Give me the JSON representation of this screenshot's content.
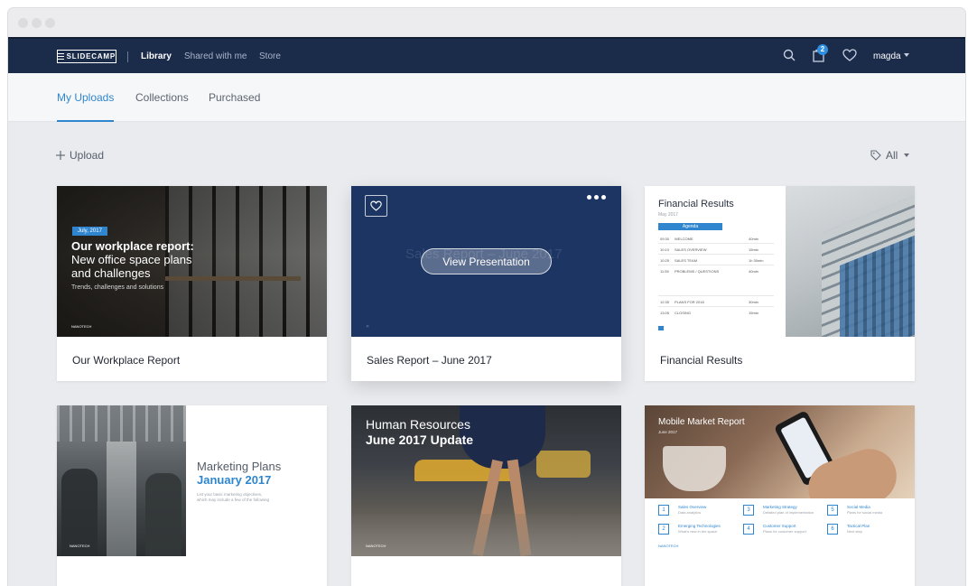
{
  "nav": {
    "logo_text": "SLIDECAMP",
    "links": [
      "Library",
      "Shared with me",
      "Store"
    ],
    "cart_count": "2",
    "user_name": "magda"
  },
  "tabs": [
    "My Uploads",
    "Collections",
    "Purchased"
  ],
  "toolbar": {
    "upload_label": "Upload",
    "filter_label": "All"
  },
  "hover": {
    "view_label": "View Presentation"
  },
  "cards": [
    {
      "title": "Our Workplace Report",
      "thumb": {
        "date_tag": "July, 2017",
        "heading": "Our workplace report:",
        "subheading_1": "New office space plans",
        "subheading_2": "and challenges",
        "small": "Trends, challenges and solutions",
        "logo": "NANOTECH"
      }
    },
    {
      "title": "Sales Report – June 2017",
      "thumb": {
        "faded": "Sales Report – June 2017"
      }
    },
    {
      "title": "Financial Results",
      "thumb": {
        "heading": "Financial Results",
        "date": "May 2017",
        "agenda": "Agenda",
        "rows": [
          [
            "09:30",
            "WELCOME",
            "40min"
          ],
          [
            "10:10",
            "SALES OVERVIEW",
            "15min"
          ],
          [
            "10:25",
            "SALES TEAM",
            "1h 30min"
          ],
          [
            "11:55",
            "PROBLEMS / QUESTIONS",
            "40min"
          ],
          [
            "12:35",
            "PLANS FOR 2018",
            "30min"
          ],
          [
            "13:05",
            "CLOSING",
            "15min"
          ]
        ]
      }
    },
    {
      "title": "",
      "thumb": {
        "heading": "Marketing Plans",
        "subheading": "January 2017",
        "small_1": "List your basic marketing objectives,",
        "small_2": "which may include a few of the following",
        "logo": "NANOTECH"
      }
    },
    {
      "title": "",
      "thumb": {
        "heading": "Human Resources",
        "subheading": "June 2017 Update",
        "logo": "NANOTECH"
      }
    },
    {
      "title": "",
      "thumb": {
        "heading": "Mobile Market Report",
        "date": "June 2017",
        "items": [
          {
            "n": "1",
            "t": "Sales Overview",
            "s": "Data analytics"
          },
          {
            "n": "3",
            "t": "Marketing Strategy",
            "s": "Detailed plan of implementation"
          },
          {
            "n": "5",
            "t": "Social Media",
            "s": "Plans for social media"
          },
          {
            "n": "2",
            "t": "Emerging Technologies",
            "s": "What's new in the space"
          },
          {
            "n": "4",
            "t": "Customer Support",
            "s": "Plans for customer support"
          },
          {
            "n": "6",
            "t": "Tactical Plan",
            "s": "Next step"
          }
        ],
        "logo": "NANOTECH"
      }
    }
  ],
  "colors": {
    "navbar": "#1b2b4a",
    "accent": "#2f86cf",
    "badge": "#2f8fe0"
  }
}
